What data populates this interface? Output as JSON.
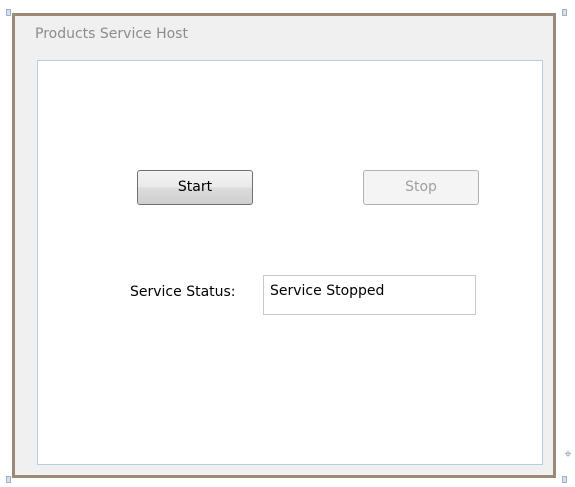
{
  "window": {
    "title": "Products Service Host"
  },
  "controls": {
    "start_label": "Start",
    "stop_label": "Stop",
    "status_label": "Service Status:",
    "status_value": "Service Stopped"
  },
  "icons": {
    "resize_grip": "move-grip-icon"
  },
  "colors": {
    "frame_border": "#9a8a76",
    "panel_border": "#b9cde0",
    "title_text": "#8c8c8c",
    "disabled_text": "#a0a0a0"
  }
}
